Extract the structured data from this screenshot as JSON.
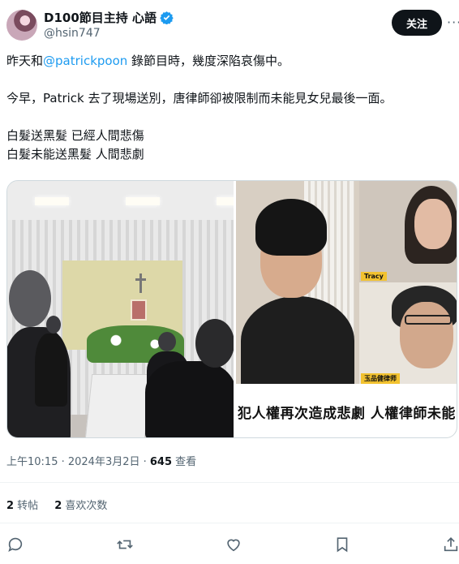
{
  "author": {
    "display_name": "D100節目主持 心語",
    "handle": "@hsin747",
    "verified": true,
    "avatar_icon": "avatar"
  },
  "header": {
    "follow_label": "关注",
    "more_label": "···"
  },
  "tweet": {
    "line1_prefix": "昨天和",
    "line1_mention": "@patrickpoon",
    "line1_suffix": " 錄節目時，幾度深陷哀傷中。",
    "line2": "今早，Patrick 去了現場送別，唐律師卻被限制而未能見女兒最後一面。",
    "line3": "白髮送黑髮 已經人間悲傷",
    "line4": "白髮未能送黑髮 人間悲劇"
  },
  "media": {
    "right_caption": "犯人權再次造成悲劇  人權律師未能",
    "tag_top": "Tracy",
    "tag_bottom": "玉品健律师"
  },
  "meta": {
    "time": "上午10:15 · 2024年3月2日 · ",
    "views_count": "645",
    "views_label": " 查看"
  },
  "stats": {
    "reposts_count": "2",
    "reposts_label": " 转帖",
    "likes_count": "2",
    "likes_label": " 喜欢次数"
  },
  "colors": {
    "accent": "#1d9bf0",
    "text": "#0f1419",
    "muted": "#536471",
    "follow_bg": "#0f1419"
  }
}
